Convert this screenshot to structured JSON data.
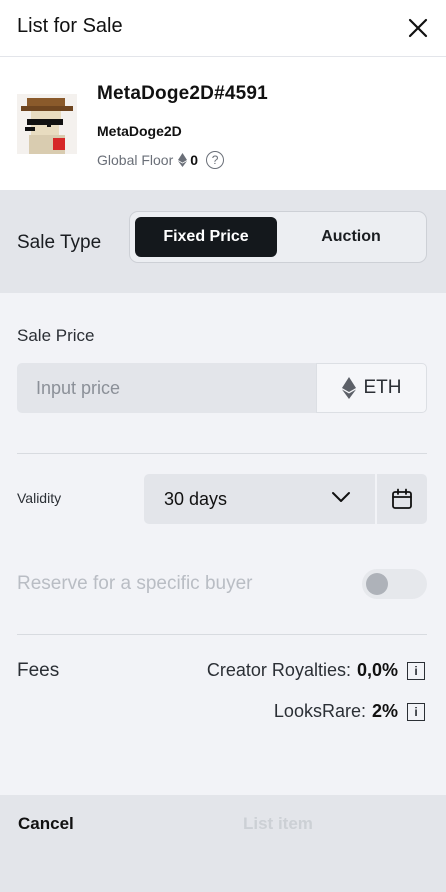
{
  "header": {
    "title": "List for Sale",
    "close_icon": "close-icon"
  },
  "item": {
    "name": "MetaDoge2D#4591",
    "collection": "MetaDoge2D",
    "floor_label": "Global Floor",
    "floor_value": "0",
    "help_glyph": "?"
  },
  "sale_type": {
    "label": "Sale Type",
    "options": [
      "Fixed Price",
      "Auction"
    ],
    "selected": "Fixed Price"
  },
  "price": {
    "label": "Sale Price",
    "placeholder": "Input price",
    "currency": "ETH"
  },
  "validity": {
    "label": "Validity",
    "value": "30 days",
    "icon": "calendar-icon"
  },
  "reserve": {
    "label": "Reserve for a specific buyer",
    "enabled": false
  },
  "fees": {
    "label": "Fees",
    "rows": [
      {
        "label": "Creator Royalties:",
        "value": "0,0%"
      },
      {
        "label": "LooksRare:",
        "value": "2%"
      }
    ],
    "info_glyph": "i"
  },
  "footer": {
    "cancel": "Cancel",
    "submit": "List item"
  },
  "colors": {
    "accent_dark": "#14181c",
    "panel": "#e3e5ea",
    "background": "#f2f3f7"
  }
}
